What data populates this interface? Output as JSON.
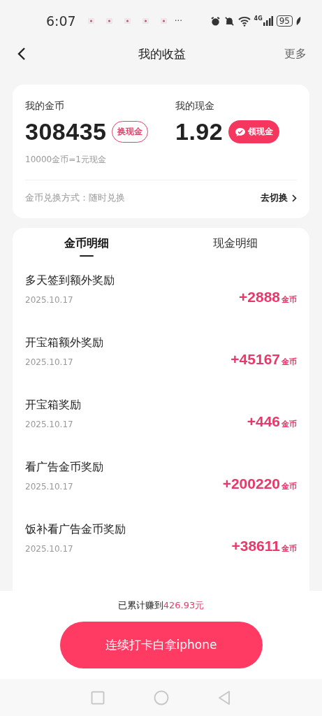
{
  "status_bar": {
    "time": "6:07",
    "more": "···",
    "network": "4G",
    "battery": "95"
  },
  "nav": {
    "title": "我的收益",
    "action": "更多"
  },
  "summary": {
    "coins_label": "我的金币",
    "coins": "308435",
    "exchange_button": "换现金",
    "cash_label": "我的现金",
    "cash": "1.92",
    "withdraw_button": "领现金",
    "rate": "10000金币=1元现金",
    "mode": "金币兑换方式：随时兑换",
    "switch_link": "去切换"
  },
  "tabs": [
    {
      "label": "金币明细",
      "selected": true
    },
    {
      "label": "现金明细",
      "selected": false
    }
  ],
  "records": [
    {
      "title": "多天签到额外奖励",
      "date": "2025.10.17",
      "amount": "+2888",
      "unit": "金币"
    },
    {
      "title": "开宝箱额外奖励",
      "date": "2025.10.17",
      "amount": "+45167",
      "unit": "金币"
    },
    {
      "title": "开宝箱奖励",
      "date": "2025.10.17",
      "amount": "+446",
      "unit": "金币"
    },
    {
      "title": "看广告金币奖励",
      "date": "2025.10.17",
      "amount": "+200220",
      "unit": "金币"
    },
    {
      "title": "饭补看广告金币奖励",
      "date": "2025.10.17",
      "amount": "+38611",
      "unit": "金币"
    }
  ],
  "footer": {
    "total_prefix": "已累计赚到",
    "total_amount": "426.93元",
    "cta_button": "连续打卡白拿iphone"
  }
}
